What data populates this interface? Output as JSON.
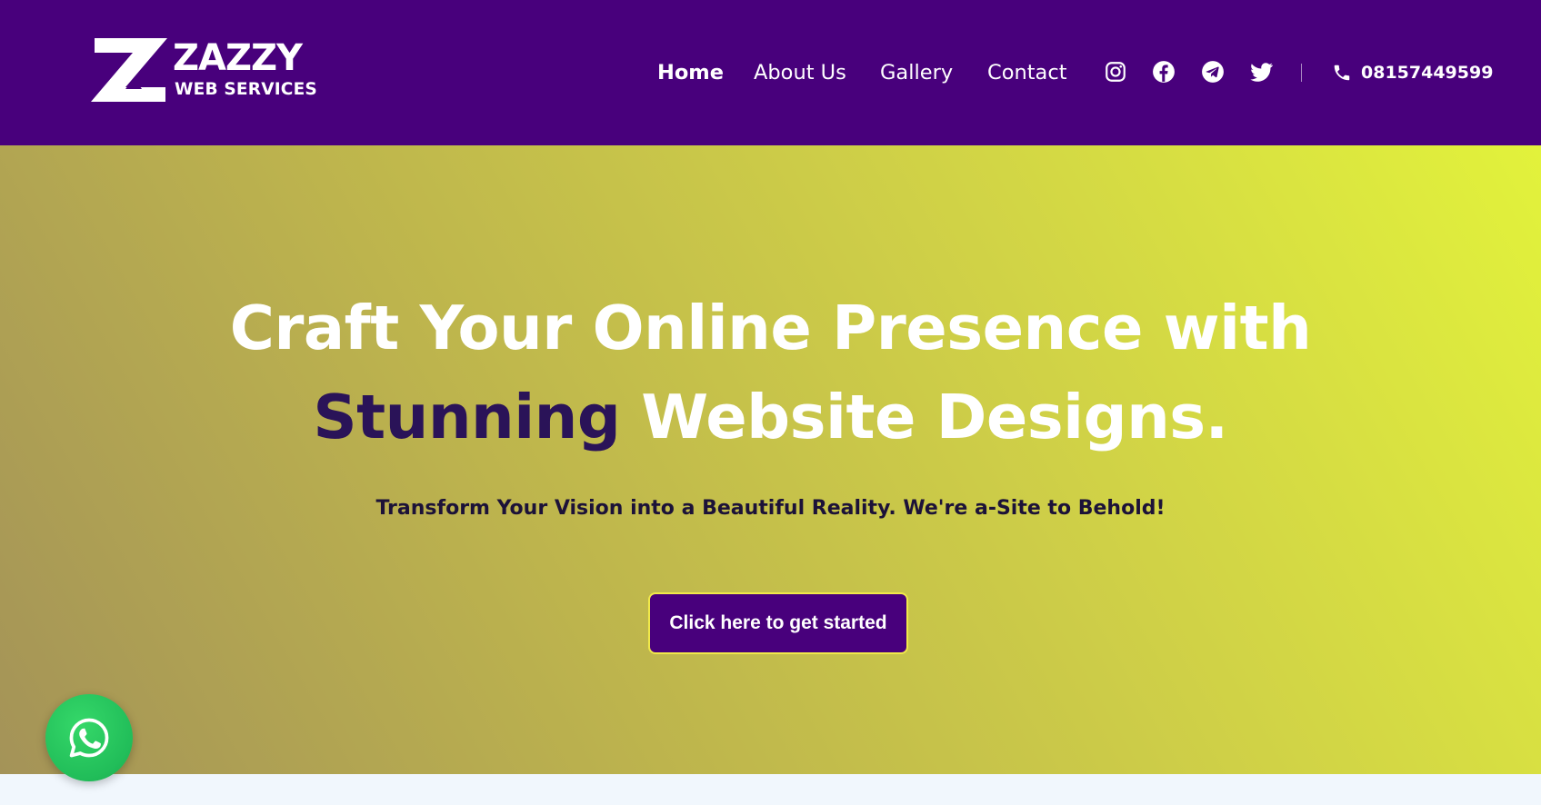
{
  "brand": {
    "name": "ZAZZY",
    "tagline": "WEB SERVICES",
    "header_color": "#48007c"
  },
  "nav": {
    "items": [
      {
        "label": "Home",
        "active": true
      },
      {
        "label": "About Us",
        "active": false
      },
      {
        "label": "Gallery",
        "active": false
      },
      {
        "label": "Contact",
        "active": false
      }
    ],
    "social_icons": [
      "instagram-icon",
      "facebook-icon",
      "telegram-icon",
      "twitter-icon"
    ],
    "phone": "08157449599"
  },
  "hero": {
    "title_line1": "Craft Your Online Presence with",
    "title_accent": "Stunning",
    "title_line2_rest": "Website Designs.",
    "subtitle": "Transform Your Vision into a Beautiful Reality. We're a-Site to Behold!",
    "cta_label": "Click here to get started",
    "accent_color": "#2a1358",
    "gradient": [
      "#a49358",
      "#e2f23b"
    ]
  },
  "floating": {
    "whatsapp_icon": "whatsapp-icon",
    "color": "#21bd59"
  }
}
